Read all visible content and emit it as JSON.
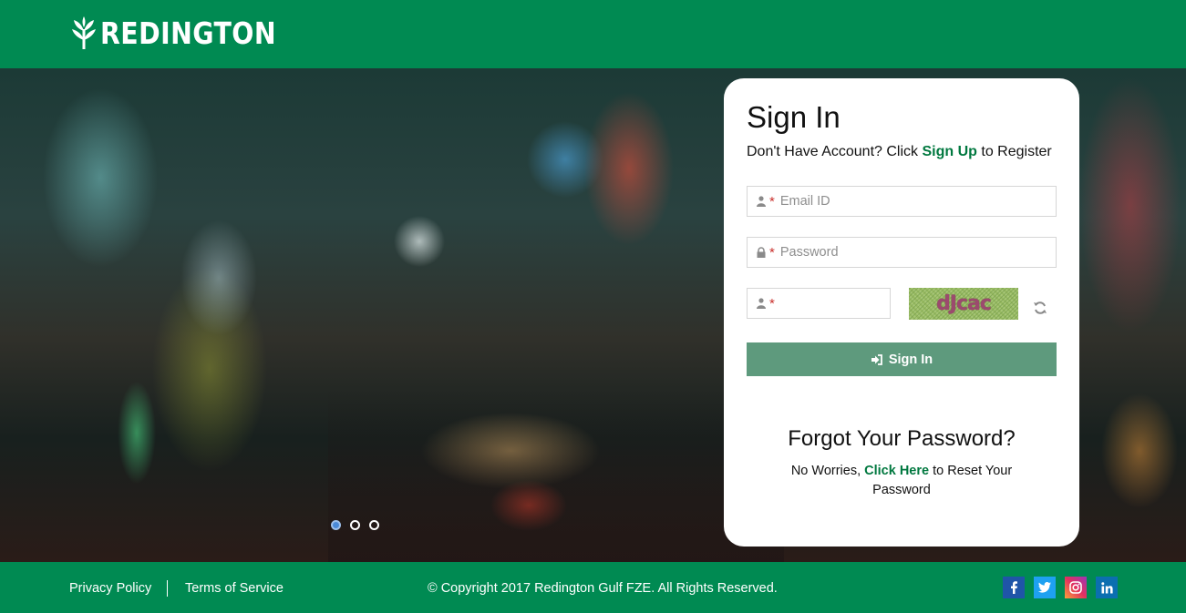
{
  "header": {
    "brand": "REDINGTON"
  },
  "carousel": {
    "slides": 3,
    "active_index": 0
  },
  "signin": {
    "title": "Sign In",
    "prompt_before": "Don't Have Account? Click ",
    "signup_link": "Sign Up",
    "prompt_after": " to Register",
    "email_placeholder": "Email ID",
    "password_placeholder": "Password",
    "captcha_text": "dJcac",
    "button_label": "Sign In"
  },
  "forgot": {
    "title": "Forgot Your Password?",
    "text_before": "No Worries, ",
    "link": "Click Here",
    "text_after": " to Reset Your Password"
  },
  "footer": {
    "privacy": "Privacy Policy",
    "terms": "Terms of Service",
    "copyright": "© Copyright 2017 Redington Gulf FZE. All Rights Reserved.",
    "social": [
      "facebook-icon",
      "twitter-icon",
      "instagram-icon",
      "linkedin-icon"
    ]
  },
  "colors": {
    "brand_green": "#008a52",
    "button_green": "#5e9a7d",
    "link_green": "#00783f",
    "required_red": "#c9302c"
  }
}
